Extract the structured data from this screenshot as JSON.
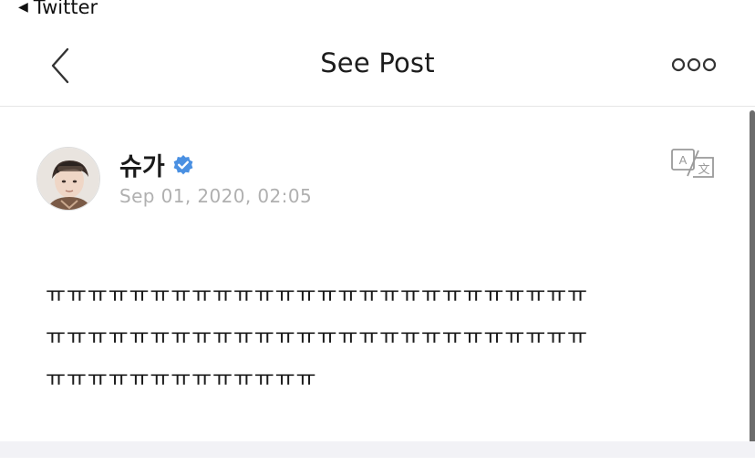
{
  "status_bar": {
    "back_app": "Twitter"
  },
  "header": {
    "title": "See Post"
  },
  "post": {
    "author_name": "슈가",
    "verified": true,
    "timestamp": "Sep 01, 2020, 02:05",
    "body_lines": [
      "ㅠㅠㅠㅠㅠㅠㅠㅠㅠㅠㅠㅠㅠㅠㅠㅠㅠㅠㅠㅠㅠㅠㅠㅠㅠㅠ",
      "ㅠㅠㅠㅠㅠㅠㅠㅠㅠㅠㅠㅠㅠㅠㅠㅠㅠㅠㅠㅠㅠㅠㅠㅠㅠㅠ",
      "ㅠㅠㅠㅠㅠㅠㅠㅠㅠㅠㅠㅠㅠ"
    ]
  },
  "colors": {
    "verified_badge": "#4a90e2",
    "timestamp": "#b0b0b0",
    "divider_band": "#f2f2f6"
  },
  "icons": {
    "back": "chevron-left-icon",
    "more": "more-dots-icon",
    "translate": "translate-icon",
    "verified": "verified-badge-icon"
  }
}
